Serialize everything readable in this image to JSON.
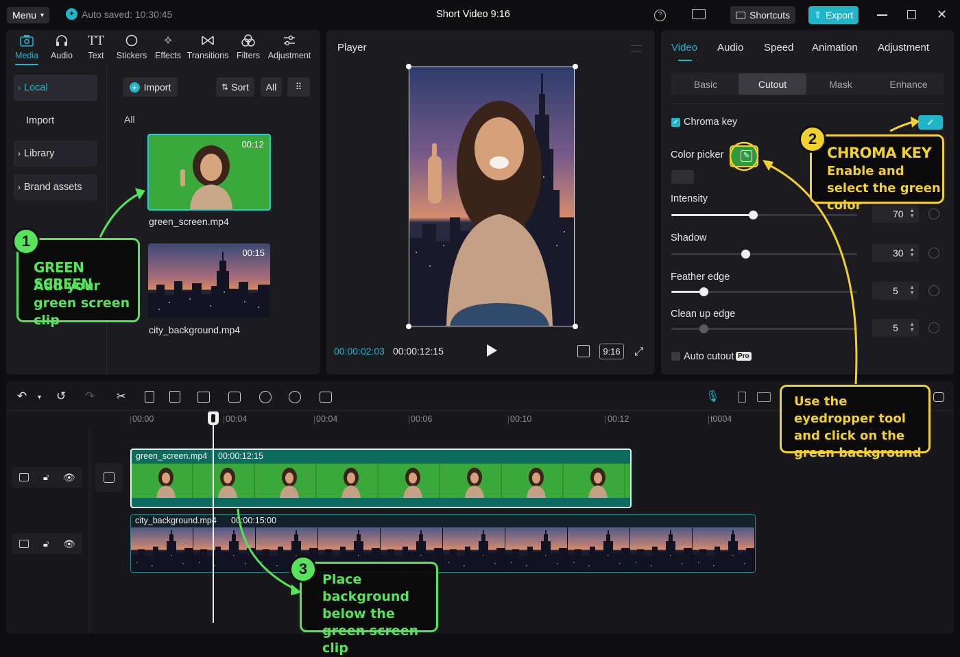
{
  "topbar": {
    "menu_label": "Menu",
    "autosave_text": "Auto saved: 10:30:45",
    "project_title": "Short Video 9:16",
    "shortcuts_label": "Shortcuts",
    "export_label": "Export"
  },
  "media_toolbar": [
    "Media",
    "Audio",
    "Text",
    "Stickers",
    "Effects",
    "Transitions",
    "Filters",
    "Adjustment"
  ],
  "sidebar": {
    "local": "Local",
    "import": "Import",
    "library": "Library",
    "brand_assets": "Brand assets"
  },
  "media_panel": {
    "import_label": "Import",
    "sort_label": "Sort",
    "all_filter": "All",
    "section_label": "All",
    "clips": [
      {
        "name": "green_screen.mp4",
        "duration": "00:12"
      },
      {
        "name": "city_background.mp4",
        "duration": "00:15"
      }
    ]
  },
  "player": {
    "title": "Player",
    "current_time": "00:00:02:03",
    "total_time": "00:00:12:15",
    "ratio": "9:16"
  },
  "right_panel": {
    "tabs": [
      "Video",
      "Audio",
      "Speed",
      "Animation",
      "Adjustment"
    ],
    "active_tab": "Video",
    "subtabs": [
      "Basic",
      "Cutout",
      "Mask",
      "Enhance"
    ],
    "active_subtab": "Cutout",
    "chroma_key_label": "Chroma key",
    "chroma_key_enabled": true,
    "color_picker_label": "Color picker",
    "sliders": [
      {
        "label": "Intensity",
        "value": "70"
      },
      {
        "label": "Shadow",
        "value": "30"
      },
      {
        "label": "Feather edge",
        "value": "5"
      },
      {
        "label": "Clean up edge",
        "value": "5"
      }
    ],
    "auto_cutout_label": "Auto cutout",
    "pro_badge": "Pro"
  },
  "timeline": {
    "ruler": [
      "00:00",
      "00:04",
      "00:04",
      "00:06",
      "00:10",
      "00:12",
      "t0004"
    ],
    "clip1": {
      "name": "green_screen.mp4",
      "duration": "00:00:12:15"
    },
    "clip2": {
      "name": "city_background.mp4",
      "duration": "00:00:15:00"
    }
  },
  "callouts": {
    "c1": {
      "num": "1",
      "title": "GREEN SCREEN",
      "text": "Add your green screen clip"
    },
    "c2": {
      "num": "2",
      "title": "CHROMA KEY",
      "text": "Enable and select the green color"
    },
    "c3": {
      "text": "Use the eyedropper tool and click on the green background"
    },
    "c4": {
      "num": "3",
      "text": "Place background below the green screen clip"
    }
  },
  "colors": {
    "accent": "#1fb6c9",
    "green_callout": "#57e35a",
    "yellow_callout": "#f2d12e",
    "green_screen": "#3aa83b"
  }
}
